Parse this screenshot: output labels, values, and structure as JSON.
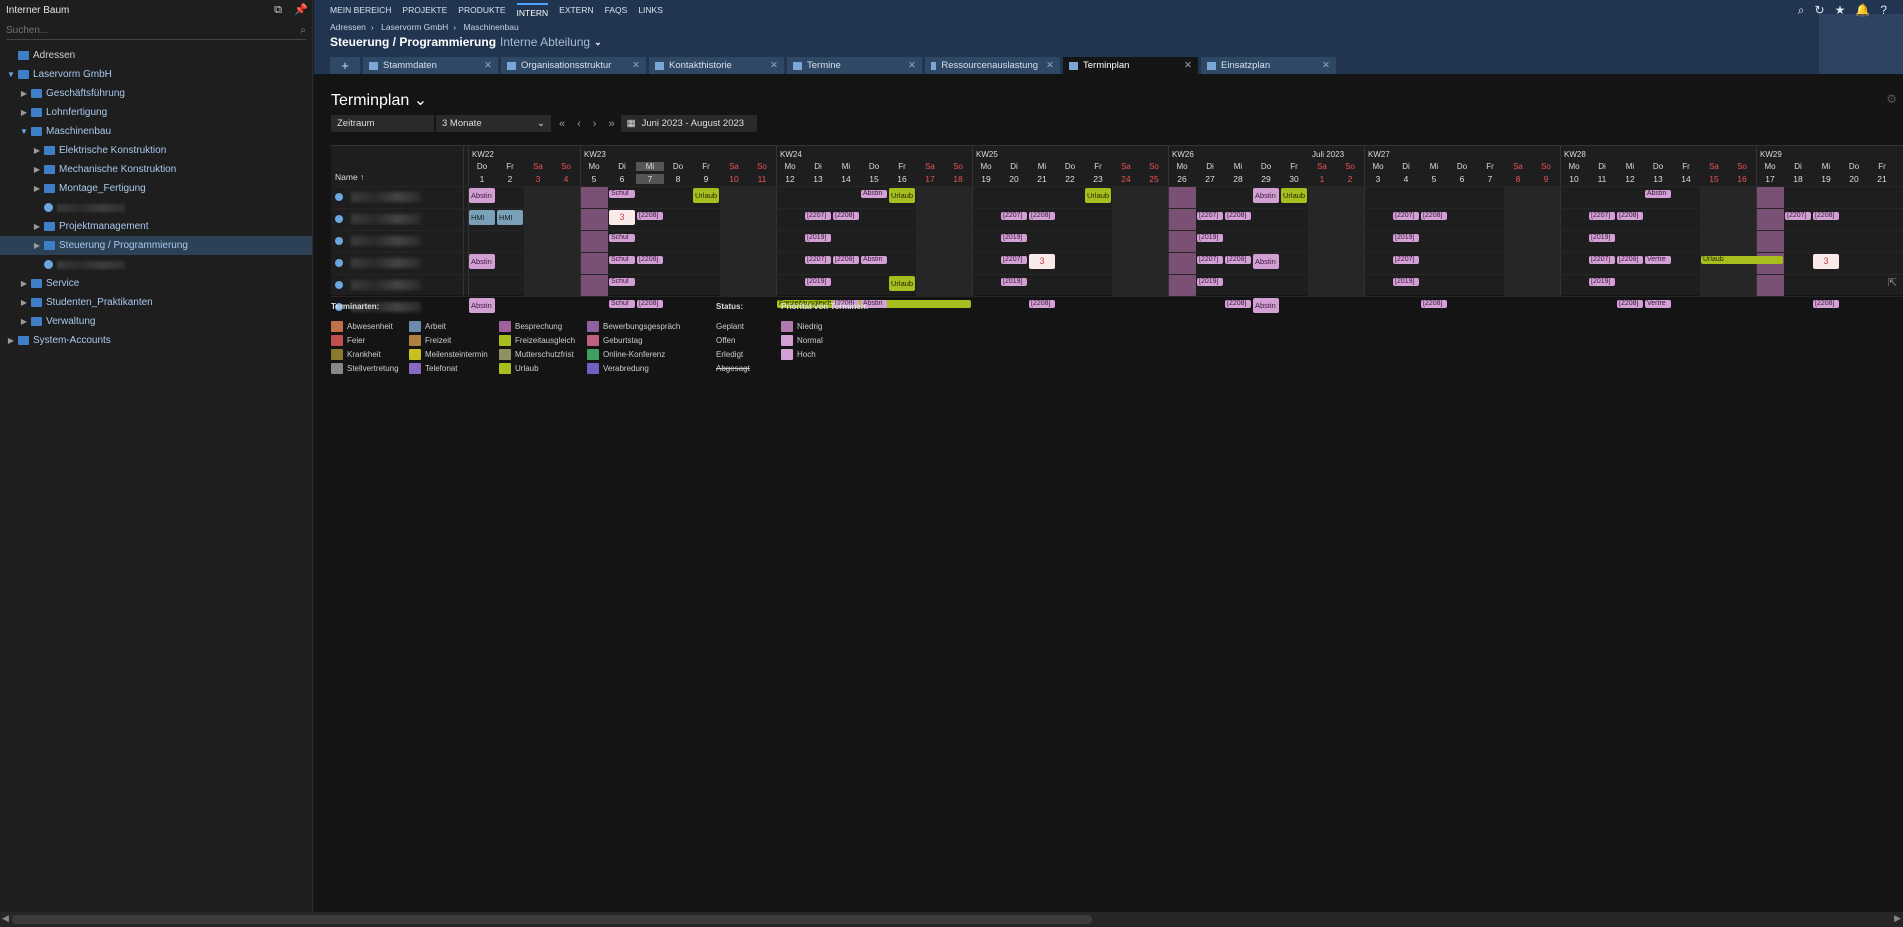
{
  "sidebar": {
    "title": "Interner Baum",
    "search_placeholder": "Suchen...",
    "items": [
      {
        "label": "Adressen",
        "level": 0,
        "toggle": "",
        "type": "root"
      },
      {
        "label": "Laservorm GmbH",
        "level": 0,
        "toggle": "▼",
        "type": "org"
      },
      {
        "label": "Geschäftsführung",
        "level": 1,
        "toggle": "▶",
        "type": "dept"
      },
      {
        "label": "Lohnfertigung",
        "level": 1,
        "toggle": "▶",
        "type": "dept"
      },
      {
        "label": "Maschinenbau",
        "level": 1,
        "toggle": "▼",
        "type": "dept"
      },
      {
        "label": "Elektrische Konstruktion",
        "level": 2,
        "toggle": "▶",
        "type": "dept"
      },
      {
        "label": "Mechanische Konstruktion",
        "level": 2,
        "toggle": "▶",
        "type": "dept"
      },
      {
        "label": "Montage_Fertigung",
        "level": 2,
        "toggle": "▶",
        "type": "dept"
      },
      {
        "label": "",
        "level": 2,
        "toggle": "",
        "type": "person"
      },
      {
        "label": "Projektmanagement",
        "level": 2,
        "toggle": "▶",
        "type": "dept"
      },
      {
        "label": "Steuerung / Programmierung",
        "level": 2,
        "toggle": "▶",
        "type": "dept",
        "selected": true
      },
      {
        "label": "",
        "level": 2,
        "toggle": "",
        "type": "person"
      },
      {
        "label": "Service",
        "level": 1,
        "toggle": "▶",
        "type": "dept"
      },
      {
        "label": "Studenten_Praktikanten",
        "level": 1,
        "toggle": "▶",
        "type": "dept"
      },
      {
        "label": "Verwaltung",
        "level": 1,
        "toggle": "▶",
        "type": "dept"
      },
      {
        "label": "System-Accounts",
        "level": 0,
        "toggle": "▶",
        "type": "org"
      }
    ]
  },
  "topnav": {
    "items": [
      "MEIN BEREICH",
      "PROJEKTE",
      "PRODUKTE",
      "INTERN",
      "EXTERN",
      "FAQS",
      "LINKS"
    ],
    "active": "INTERN"
  },
  "breadcrumb": [
    "Adressen",
    "Laservorm GmbH",
    "Maschinenbau"
  ],
  "page_title": "Steuerung / Programmierung",
  "page_subtitle": "Interne Abteilung",
  "tabs": [
    "Stammdaten",
    "Organisationsstruktur",
    "Kontakthistorie",
    "Termine",
    "Ressourcenauslastung",
    "Terminplan",
    "Einsatzplan"
  ],
  "active_tab": "Terminplan",
  "main": {
    "heading": "Terminplan",
    "range_label": "Zeitraum",
    "range_value": "3 Monate",
    "period": "Juni 2023 - August 2023",
    "name_header": "Name"
  },
  "calendar": {
    "weeks": [
      {
        "label": "KW22",
        "start": 0
      },
      {
        "label": "KW23",
        "start": 4
      },
      {
        "label": "KW24",
        "start": 11
      },
      {
        "label": "KW25",
        "start": 18
      },
      {
        "label": "KW26",
        "start": 25
      },
      {
        "label": "KW27",
        "start": 32
      },
      {
        "label": "KW28",
        "start": 39
      },
      {
        "label": "KW29",
        "start": 46
      }
    ],
    "month_label": "Juli 2023",
    "days": [
      [
        "Do",
        "1"
      ],
      [
        "Fr",
        "2"
      ],
      [
        "Sa",
        "3"
      ],
      [
        "So",
        "4"
      ],
      [
        "Mo",
        "5"
      ],
      [
        "Di",
        "6"
      ],
      [
        "Mi",
        "7"
      ],
      [
        "Do",
        "8"
      ],
      [
        "Fr",
        "9"
      ],
      [
        "Sa",
        "10"
      ],
      [
        "So",
        "11"
      ],
      [
        "Mo",
        "12"
      ],
      [
        "Di",
        "13"
      ],
      [
        "Mi",
        "14"
      ],
      [
        "Do",
        "15"
      ],
      [
        "Fr",
        "16"
      ],
      [
        "Sa",
        "17"
      ],
      [
        "So",
        "18"
      ],
      [
        "Mo",
        "19"
      ],
      [
        "Di",
        "20"
      ],
      [
        "Mi",
        "21"
      ],
      [
        "Do",
        "22"
      ],
      [
        "Fr",
        "23"
      ],
      [
        "Sa",
        "24"
      ],
      [
        "So",
        "25"
      ],
      [
        "Mo",
        "26"
      ],
      [
        "Di",
        "27"
      ],
      [
        "Mi",
        "28"
      ],
      [
        "Do",
        "29"
      ],
      [
        "Fr",
        "30"
      ],
      [
        "Sa",
        "1"
      ],
      [
        "So",
        "2"
      ],
      [
        "Mo",
        "3"
      ],
      [
        "Di",
        "4"
      ],
      [
        "Mi",
        "5"
      ],
      [
        "Do",
        "6"
      ],
      [
        "Fr",
        "7"
      ],
      [
        "Sa",
        "8"
      ],
      [
        "So",
        "9"
      ],
      [
        "Mo",
        "10"
      ],
      [
        "Di",
        "11"
      ],
      [
        "Mi",
        "12"
      ],
      [
        "Do",
        "13"
      ],
      [
        "Fr",
        "14"
      ],
      [
        "Sa",
        "15"
      ],
      [
        "So",
        "16"
      ],
      [
        "Mo",
        "17"
      ],
      [
        "Di",
        "18"
      ],
      [
        "Mi",
        "19"
      ],
      [
        "Do",
        "20"
      ],
      [
        "Fr",
        "21"
      ]
    ],
    "today_index": 6,
    "events": [
      {
        "row": 0,
        "d": 0,
        "w": 1,
        "t": "Abstin",
        "c": "p"
      },
      {
        "row": 0,
        "d": 5,
        "w": 1,
        "t": "Schul",
        "c": "p",
        "sm": 1
      },
      {
        "row": 0,
        "d": 8,
        "w": 1,
        "t": "Urlaub",
        "c": "g"
      },
      {
        "row": 0,
        "d": 14,
        "w": 1,
        "t": "Abstin",
        "c": "p",
        "sm": 1
      },
      {
        "row": 0,
        "d": 15,
        "w": 1,
        "t": "Urlaub",
        "c": "g"
      },
      {
        "row": 0,
        "d": 22,
        "w": 1,
        "t": "Urlaub",
        "c": "g"
      },
      {
        "row": 0,
        "d": 28,
        "w": 1,
        "t": "Abstin",
        "c": "p"
      },
      {
        "row": 0,
        "d": 29,
        "w": 1,
        "t": "Urlaub",
        "c": "g"
      },
      {
        "row": 0,
        "d": 42,
        "w": 1,
        "t": "Abstin",
        "c": "p",
        "sm": 1
      },
      {
        "row": 1,
        "d": 0,
        "w": 1,
        "t": "HMI",
        "c": "b"
      },
      {
        "row": 1,
        "d": 1,
        "w": 1,
        "t": "HMI",
        "c": "b"
      },
      {
        "row": 1,
        "d": 5,
        "w": 1,
        "t": "3",
        "c": "num"
      },
      {
        "row": 1,
        "d": 6,
        "w": 1,
        "t": "[2208]",
        "c": "p",
        "sm": 1
      },
      {
        "row": 1,
        "d": 12,
        "w": 1,
        "t": "[2207]",
        "c": "p",
        "sm": 1
      },
      {
        "row": 1,
        "d": 13,
        "w": 1,
        "t": "[2208]",
        "c": "p",
        "sm": 1
      },
      {
        "row": 1,
        "d": 19,
        "w": 1,
        "t": "[2207]",
        "c": "p",
        "sm": 1
      },
      {
        "row": 1,
        "d": 20,
        "w": 1,
        "t": "[2208]",
        "c": "p",
        "sm": 1
      },
      {
        "row": 1,
        "d": 26,
        "w": 1,
        "t": "[2207]",
        "c": "p",
        "sm": 1
      },
      {
        "row": 1,
        "d": 27,
        "w": 1,
        "t": "[2208]",
        "c": "p",
        "sm": 1
      },
      {
        "row": 1,
        "d": 33,
        "w": 1,
        "t": "[2207]",
        "c": "p",
        "sm": 1
      },
      {
        "row": 1,
        "d": 34,
        "w": 1,
        "t": "[2208]",
        "c": "p",
        "sm": 1
      },
      {
        "row": 1,
        "d": 40,
        "w": 1,
        "t": "[2207]",
        "c": "p",
        "sm": 1
      },
      {
        "row": 1,
        "d": 41,
        "w": 1,
        "t": "[2208]",
        "c": "p",
        "sm": 1
      },
      {
        "row": 1,
        "d": 47,
        "w": 1,
        "t": "[2207]",
        "c": "p",
        "sm": 1
      },
      {
        "row": 1,
        "d": 48,
        "w": 1,
        "t": "[2208]",
        "c": "p",
        "sm": 1
      },
      {
        "row": 2,
        "d": 5,
        "w": 1,
        "t": "Schul",
        "c": "p",
        "sm": 1
      },
      {
        "row": 2,
        "d": 12,
        "w": 1,
        "t": "[2019]",
        "c": "p",
        "sm": 1
      },
      {
        "row": 2,
        "d": 19,
        "w": 1,
        "t": "[2019]",
        "c": "p",
        "sm": 1
      },
      {
        "row": 2,
        "d": 26,
        "w": 1,
        "t": "[2019]",
        "c": "p",
        "sm": 1
      },
      {
        "row": 2,
        "d": 33,
        "w": 1,
        "t": "[2019]",
        "c": "p",
        "sm": 1
      },
      {
        "row": 2,
        "d": 40,
        "w": 1,
        "t": "[2019]",
        "c": "p",
        "sm": 1
      },
      {
        "row": 3,
        "d": 0,
        "w": 1,
        "t": "Abstin",
        "c": "p"
      },
      {
        "row": 3,
        "d": 5,
        "w": 1,
        "t": "Schul",
        "c": "p",
        "sm": 1
      },
      {
        "row": 3,
        "d": 6,
        "w": 1,
        "t": "[2208]",
        "c": "p",
        "sm": 1
      },
      {
        "row": 3,
        "d": 12,
        "w": 1,
        "t": "[2207]",
        "c": "p",
        "sm": 1
      },
      {
        "row": 3,
        "d": 13,
        "w": 1,
        "t": "[2208]",
        "c": "p",
        "sm": 1
      },
      {
        "row": 3,
        "d": 14,
        "w": 1,
        "t": "Abstin",
        "c": "p",
        "sm": 1
      },
      {
        "row": 3,
        "d": 19,
        "w": 1,
        "t": "[2207]",
        "c": "p",
        "sm": 1
      },
      {
        "row": 3,
        "d": 20,
        "w": 1,
        "t": "3",
        "c": "num"
      },
      {
        "row": 3,
        "d": 26,
        "w": 1,
        "t": "[2207]",
        "c": "p",
        "sm": 1
      },
      {
        "row": 3,
        "d": 27,
        "w": 1,
        "t": "[2208]",
        "c": "p",
        "sm": 1
      },
      {
        "row": 3,
        "d": 28,
        "w": 1,
        "t": "Abstin",
        "c": "p"
      },
      {
        "row": 3,
        "d": 33,
        "w": 1,
        "t": "[2207]",
        "c": "p",
        "sm": 1
      },
      {
        "row": 3,
        "d": 40,
        "w": 1,
        "t": "[2207]",
        "c": "p",
        "sm": 1
      },
      {
        "row": 3,
        "d": 41,
        "w": 1,
        "t": "[2208]",
        "c": "p",
        "sm": 1
      },
      {
        "row": 3,
        "d": 42,
        "w": 1,
        "t": "Vertre",
        "c": "p",
        "sm": 1
      },
      {
        "row": 3,
        "d": 44,
        "w": 3,
        "t": "Urlaub",
        "c": "g",
        "sm": 1
      },
      {
        "row": 3,
        "d": 48,
        "w": 1,
        "t": "3",
        "c": "num"
      },
      {
        "row": 4,
        "d": 5,
        "w": 1,
        "t": "Schul",
        "c": "p",
        "sm": 1
      },
      {
        "row": 4,
        "d": 12,
        "w": 1,
        "t": "[2019]",
        "c": "p",
        "sm": 1
      },
      {
        "row": 4,
        "d": 15,
        "w": 1,
        "t": "Urlaub",
        "c": "g"
      },
      {
        "row": 4,
        "d": 19,
        "w": 1,
        "t": "[2019]",
        "c": "p",
        "sm": 1
      },
      {
        "row": 4,
        "d": 26,
        "w": 1,
        "t": "[2019]",
        "c": "p",
        "sm": 1
      },
      {
        "row": 4,
        "d": 33,
        "w": 1,
        "t": "[2019]",
        "c": "p",
        "sm": 1
      },
      {
        "row": 4,
        "d": 40,
        "w": 1,
        "t": "[2019]",
        "c": "p",
        "sm": 1
      },
      {
        "row": 5,
        "d": 0,
        "w": 1,
        "t": "Abstin",
        "c": "p"
      },
      {
        "row": 5,
        "d": 5,
        "w": 1,
        "t": "Schul",
        "c": "p",
        "sm": 1
      },
      {
        "row": 5,
        "d": 6,
        "w": 1,
        "t": "[2208]",
        "c": "p",
        "sm": 1
      },
      {
        "row": 5,
        "d": 11,
        "w": 7,
        "t": "Freizeitausgleich",
        "c": "g",
        "sm": 1
      },
      {
        "row": 5,
        "d": 13,
        "w": 1,
        "t": "[2208]",
        "c": "p",
        "sm": 1
      },
      {
        "row": 5,
        "d": 14,
        "w": 1,
        "t": "Abstin",
        "c": "p",
        "sm": 1
      },
      {
        "row": 5,
        "d": 20,
        "w": 1,
        "t": "[2208]",
        "c": "p",
        "sm": 1
      },
      {
        "row": 5,
        "d": 27,
        "w": 1,
        "t": "[2208]",
        "c": "p",
        "sm": 1
      },
      {
        "row": 5,
        "d": 28,
        "w": 1,
        "t": "Abstin",
        "c": "p"
      },
      {
        "row": 5,
        "d": 34,
        "w": 1,
        "t": "[2208]",
        "c": "p",
        "sm": 1
      },
      {
        "row": 5,
        "d": 41,
        "w": 1,
        "t": "[2208]",
        "c": "p",
        "sm": 1
      },
      {
        "row": 5,
        "d": 42,
        "w": 1,
        "t": "Vertre",
        "c": "p",
        "sm": 1
      },
      {
        "row": 5,
        "d": 48,
        "w": 1,
        "t": "[2208]",
        "c": "p",
        "sm": 1
      }
    ]
  },
  "legend": {
    "types_title": "Terminarten:",
    "types": [
      [
        {
          "l": "Abwesenheit",
          "c": "#c0704a"
        },
        {
          "l": "Feier",
          "c": "#c05050"
        },
        {
          "l": "Krankheit",
          "c": "#8a7a30"
        },
        {
          "l": "Stellvertretung",
          "c": "#888888"
        }
      ],
      [
        {
          "l": "Arbeit",
          "c": "#6a8ab0"
        },
        {
          "l": "Freizeit",
          "c": "#b08040"
        },
        {
          "l": "Meilensteintermin",
          "c": "#c8c020"
        },
        {
          "l": "Telefonat",
          "c": "#8a6ac0"
        }
      ],
      [
        {
          "l": "Besprechung",
          "c": "#a060a0"
        },
        {
          "l": "Freizeitausgleich",
          "c": "#a8bd1e"
        },
        {
          "l": "Mutterschutzfrist",
          "c": "#909060"
        },
        {
          "l": "Urlaub",
          "c": "#a8bd1e"
        }
      ],
      [
        {
          "l": "Bewerbungsgespräch",
          "c": "#9060a0"
        },
        {
          "l": "Geburtstag",
          "c": "#c06080"
        },
        {
          "l": "Online-Konferenz",
          "c": "#40a060"
        },
        {
          "l": "Verabredung",
          "c": "#7060c0"
        }
      ]
    ],
    "status_title": "Status:",
    "status": [
      "Geplant",
      "Offen",
      "Erledigt",
      "Abgesagt"
    ],
    "priority_title": "Priorität von Terminen:",
    "priority": [
      {
        "l": "Niedrig",
        "c": "#b07ab0"
      },
      {
        "l": "Normal",
        "c": "#d3a0d6"
      },
      {
        "l": "Hoch",
        "c": "#d3a0d6"
      }
    ]
  }
}
